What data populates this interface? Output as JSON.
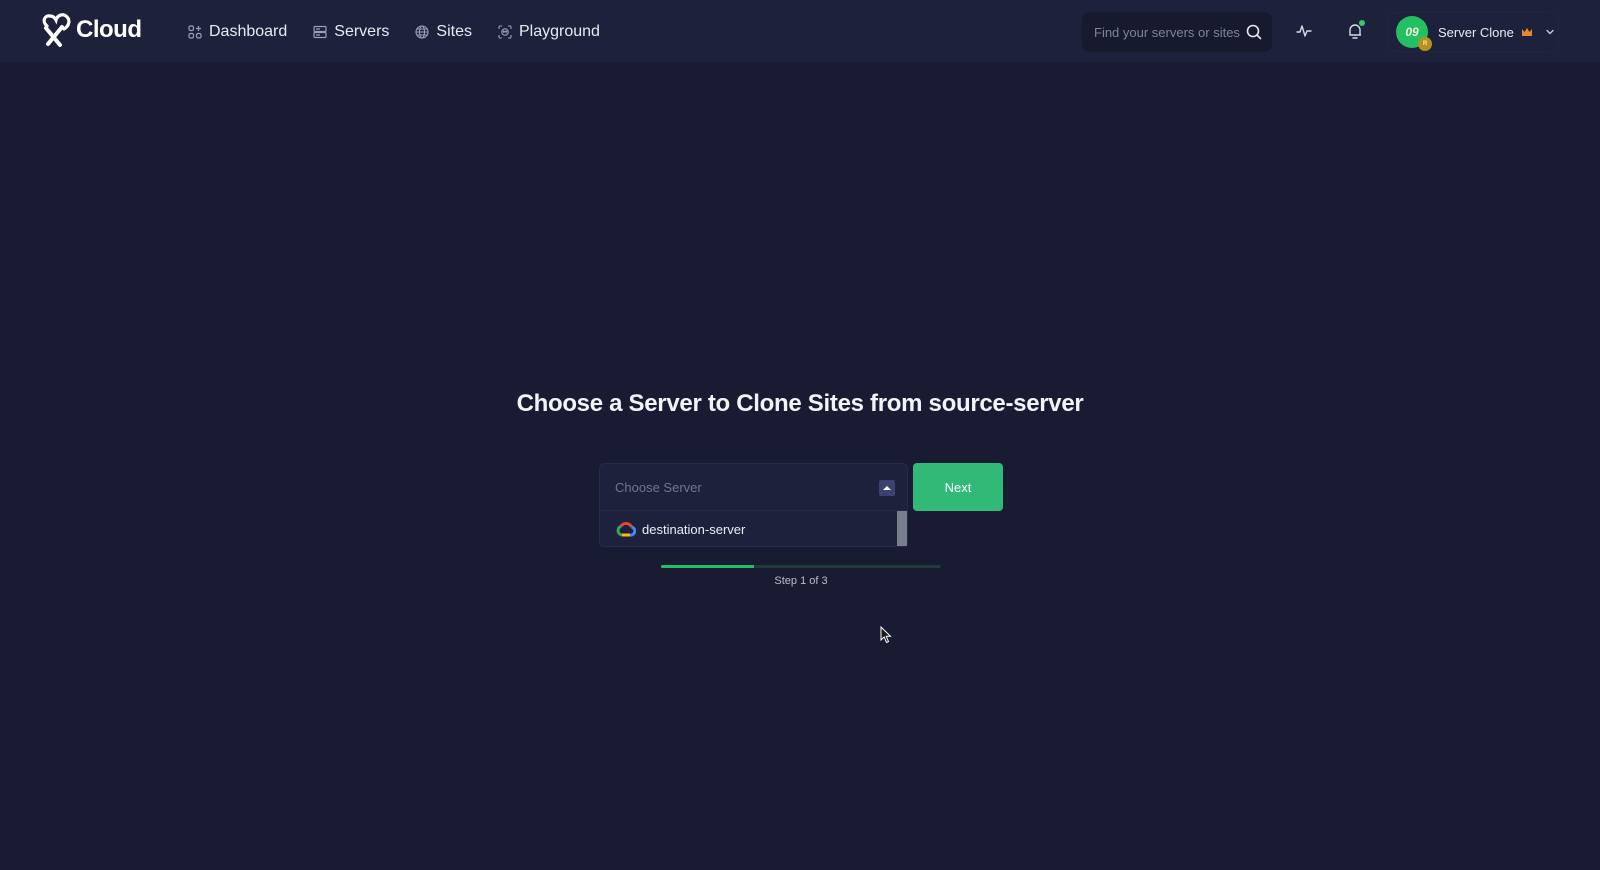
{
  "header": {
    "brand": "Cloud",
    "nav": [
      {
        "label": "Dashboard",
        "icon": "dashboard-grid-icon"
      },
      {
        "label": "Servers",
        "icon": "server-icon"
      },
      {
        "label": "Sites",
        "icon": "globe-icon"
      },
      {
        "label": "Playground",
        "icon": "playground-icon"
      }
    ],
    "search": {
      "placeholder": "Find your servers or sites",
      "value": ""
    },
    "activity_icon": "activity-pulse-icon",
    "notifications": {
      "icon": "bell-icon",
      "has_unread": true
    },
    "user": {
      "avatar_text": "09",
      "badge_text": "R",
      "name": "Server Clone",
      "crown_color": "#e8882a"
    }
  },
  "main": {
    "title_prefix": "Choose a Server to Clone Sites from ",
    "title_server": "source-server",
    "select": {
      "placeholder": "Choose Server",
      "open": true,
      "options": [
        {
          "label": "destination-server",
          "provider": "google-cloud"
        }
      ]
    },
    "next_label": "Next",
    "progress": {
      "current_step": 1,
      "total_steps": 3,
      "fraction": 0.333,
      "label": "Step 1 of 3"
    }
  },
  "colors": {
    "accent": "#31b977",
    "progress": "#22c063",
    "background": "#181b31",
    "header": "#1d213b"
  }
}
